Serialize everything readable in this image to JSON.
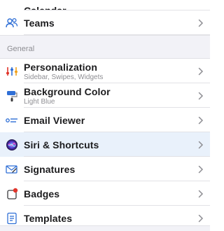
{
  "rows_top": [
    {
      "id": "calendar",
      "title": "Calendar",
      "icon": "calendar-icon"
    },
    {
      "id": "teams",
      "title": "Teams",
      "icon": "teams-icon"
    }
  ],
  "section": {
    "title": "General"
  },
  "rows": [
    {
      "id": "personalization",
      "title": "Personalization",
      "subtitle": "Sidebar, Swipes, Widgets",
      "icon": "sliders-icon"
    },
    {
      "id": "background-color",
      "title": "Background Color",
      "subtitle": "Light Blue",
      "icon": "paint-roller-icon"
    },
    {
      "id": "email-viewer",
      "title": "Email Viewer",
      "icon": "email-viewer-icon"
    },
    {
      "id": "siri-shortcuts",
      "title": "Siri & Shortcuts",
      "icon": "siri-icon",
      "selected": true
    },
    {
      "id": "signatures",
      "title": "Signatures",
      "icon": "signature-icon"
    },
    {
      "id": "badges",
      "title": "Badges",
      "icon": "badge-icon"
    },
    {
      "id": "templates",
      "title": "Templates",
      "icon": "templates-icon"
    }
  ],
  "colors": {
    "accent": "#2f6fd6",
    "selected_bg": "#e9f1fb",
    "badge_red": "#e0352b"
  }
}
